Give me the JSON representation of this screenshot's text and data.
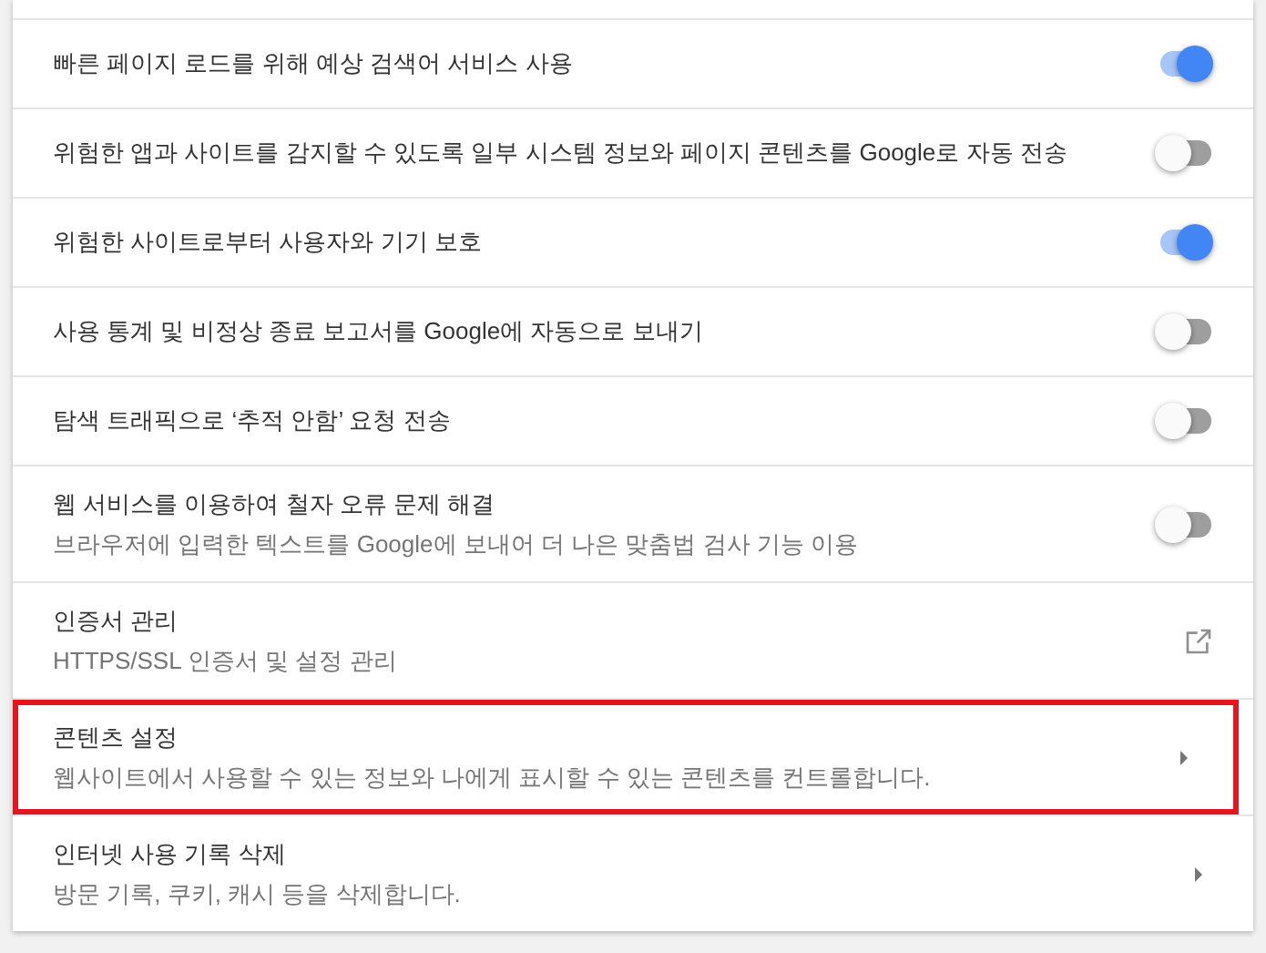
{
  "rows": [
    {
      "kind": "toggle",
      "title": "빠른 페이지 로드를 위해 예상 검색어 서비스 사용",
      "on": true,
      "highlighted": false
    },
    {
      "kind": "toggle",
      "title": "위험한 앱과 사이트를 감지할 수 있도록 일부 시스템 정보와 페이지 콘텐츠를 Google로 자동 전송",
      "on": false,
      "highlighted": false
    },
    {
      "kind": "toggle",
      "title": "위험한 사이트로부터 사용자와 기기 보호",
      "on": true,
      "highlighted": false
    },
    {
      "kind": "toggle",
      "title": "사용 통계 및 비정상 종료 보고서를 Google에 자동으로 보내기",
      "on": false,
      "highlighted": false
    },
    {
      "kind": "toggle",
      "title": "탐색 트래픽으로 ‘추적 안함’ 요청 전송",
      "on": false,
      "highlighted": false
    },
    {
      "kind": "toggle",
      "title": "웹 서비스를 이용하여 철자 오류 문제 해결",
      "subtitle": "브라우저에 입력한 텍스트를 Google에 보내어 더 나은 맞춤법 검사 기능 이용",
      "on": false,
      "highlighted": false
    },
    {
      "kind": "external",
      "title": "인증서 관리",
      "subtitle": "HTTPS/SSL 인증서 및 설정 관리",
      "highlighted": false
    },
    {
      "kind": "submenu",
      "title": "콘텐츠 설정",
      "subtitle": "웹사이트에서 사용할 수 있는 정보와 나에게 표시할 수 있는 콘텐츠를 컨트롤합니다.",
      "highlighted": true
    },
    {
      "kind": "submenu",
      "title": "인터넷 사용 기록 삭제",
      "subtitle": "방문 기록, 쿠키, 캐시 등을 삭제합니다.",
      "highlighted": false
    }
  ]
}
